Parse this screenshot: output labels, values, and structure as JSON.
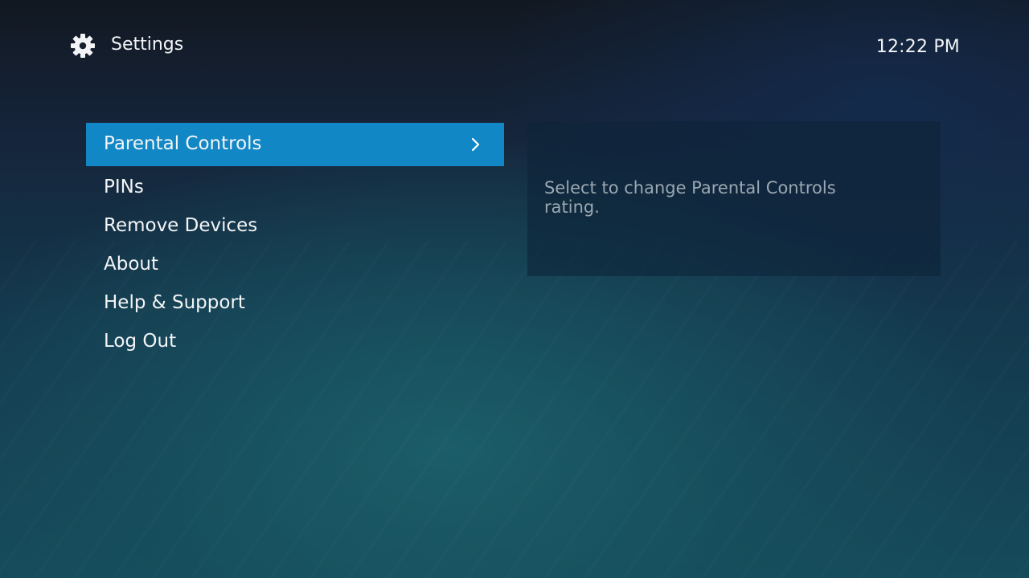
{
  "header": {
    "icon": "gear-icon",
    "title": "Settings",
    "clock": "12:22  PM"
  },
  "menu": {
    "items": [
      {
        "label": "Parental Controls",
        "selected": true
      },
      {
        "label": "PINs",
        "selected": false
      },
      {
        "label": "Remove Devices",
        "selected": false
      },
      {
        "label": "About",
        "selected": false
      },
      {
        "label": "Help & Support",
        "selected": false
      },
      {
        "label": "Log Out",
        "selected": false
      }
    ],
    "selected_icon": "chevron-right-icon"
  },
  "info_panel": {
    "description": "Select to change Parental Controls rating."
  },
  "colors": {
    "accent": "#1187c5",
    "panel": "#0d2438",
    "description_text": "#9aa8b2"
  }
}
